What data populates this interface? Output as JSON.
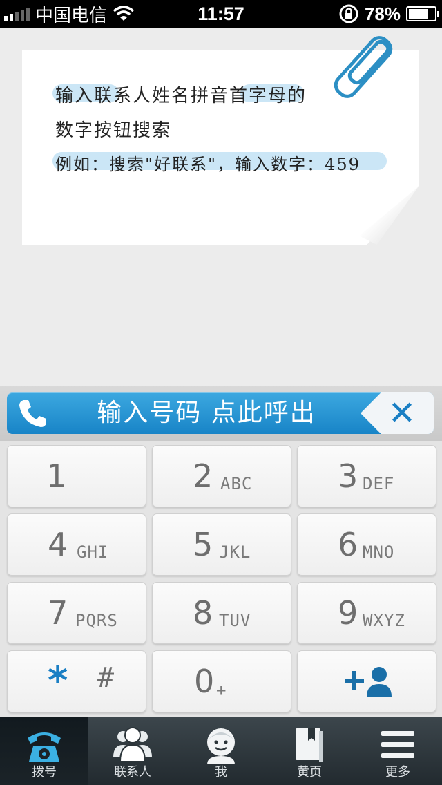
{
  "status_bar": {
    "carrier": "中国电信",
    "time": "11:57",
    "battery": "78%",
    "battery_level": 0.78
  },
  "hint_note": {
    "line1": "输入联系人姓名拼音首字母的",
    "line2": "数字按钮搜索",
    "line3": "例如：搜索\"好联系\"，输入数字：459"
  },
  "call_bar": {
    "label": "输入号码 点此呼出",
    "accent": "#1f8ed2"
  },
  "keypad": {
    "keys": [
      {
        "num": "1",
        "sub": ""
      },
      {
        "num": "2",
        "sub": "ABC"
      },
      {
        "num": "3",
        "sub": "DEF"
      },
      {
        "num": "4",
        "sub": "GHI"
      },
      {
        "num": "5",
        "sub": "JKL"
      },
      {
        "num": "6",
        "sub": "MNO"
      },
      {
        "num": "7",
        "sub": "PQRS"
      },
      {
        "num": "8",
        "sub": "TUV"
      },
      {
        "num": "9",
        "sub": "WXYZ"
      },
      {
        "num": "*",
        "sub": "#"
      },
      {
        "num": "0",
        "sub": "+"
      },
      {
        "num": "",
        "sub": ""
      }
    ]
  },
  "tabs": [
    {
      "label": "拨号",
      "icon": "phone-icon",
      "active": true
    },
    {
      "label": "联系人",
      "icon": "contacts-icon",
      "active": false
    },
    {
      "label": "我",
      "icon": "me-icon",
      "active": false
    },
    {
      "label": "黄页",
      "icon": "yellow-pages-icon",
      "active": false
    },
    {
      "label": "更多",
      "icon": "more-icon",
      "active": false
    }
  ]
}
